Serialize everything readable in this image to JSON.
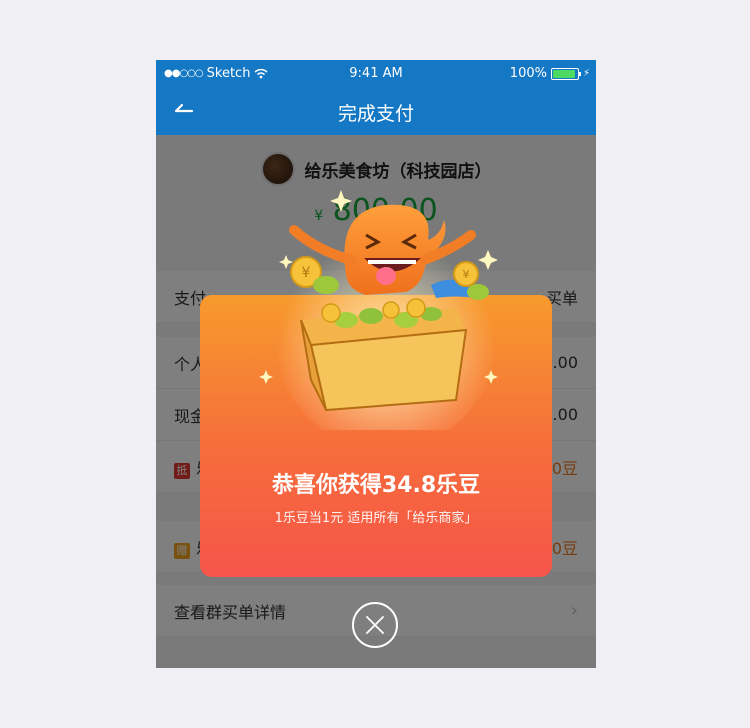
{
  "status_bar": {
    "carrier": "Sketch",
    "time": "9:41 AM",
    "battery": "100%",
    "battery_level": 1.0
  },
  "nav": {
    "title": "完成支付"
  },
  "shop": {
    "name": "给乐美食坊（科技园店）"
  },
  "payment": {
    "currency": "¥",
    "amount": "800.00"
  },
  "rows": [
    {
      "label": "支付",
      "value": "买单"
    },
    {
      "label": "个人",
      "value": ".00"
    },
    {
      "label": "现金",
      "value": ".00"
    },
    {
      "tag": "抵",
      "label": "乐",
      "value": "0豆"
    },
    {
      "tag": "赠",
      "label": "乐",
      "value": "0豆"
    }
  ],
  "detail_link": {
    "label": "查看群买单详情"
  },
  "modal": {
    "title": "恭喜你获得34.8乐豆",
    "subtitle": "1乐豆当1元 适用所有「给乐商家」"
  },
  "colors": {
    "nav": "#1578c4",
    "amount": "#19a93a",
    "modal_top": "#f79a2c",
    "modal_bottom": "#f5554a"
  }
}
